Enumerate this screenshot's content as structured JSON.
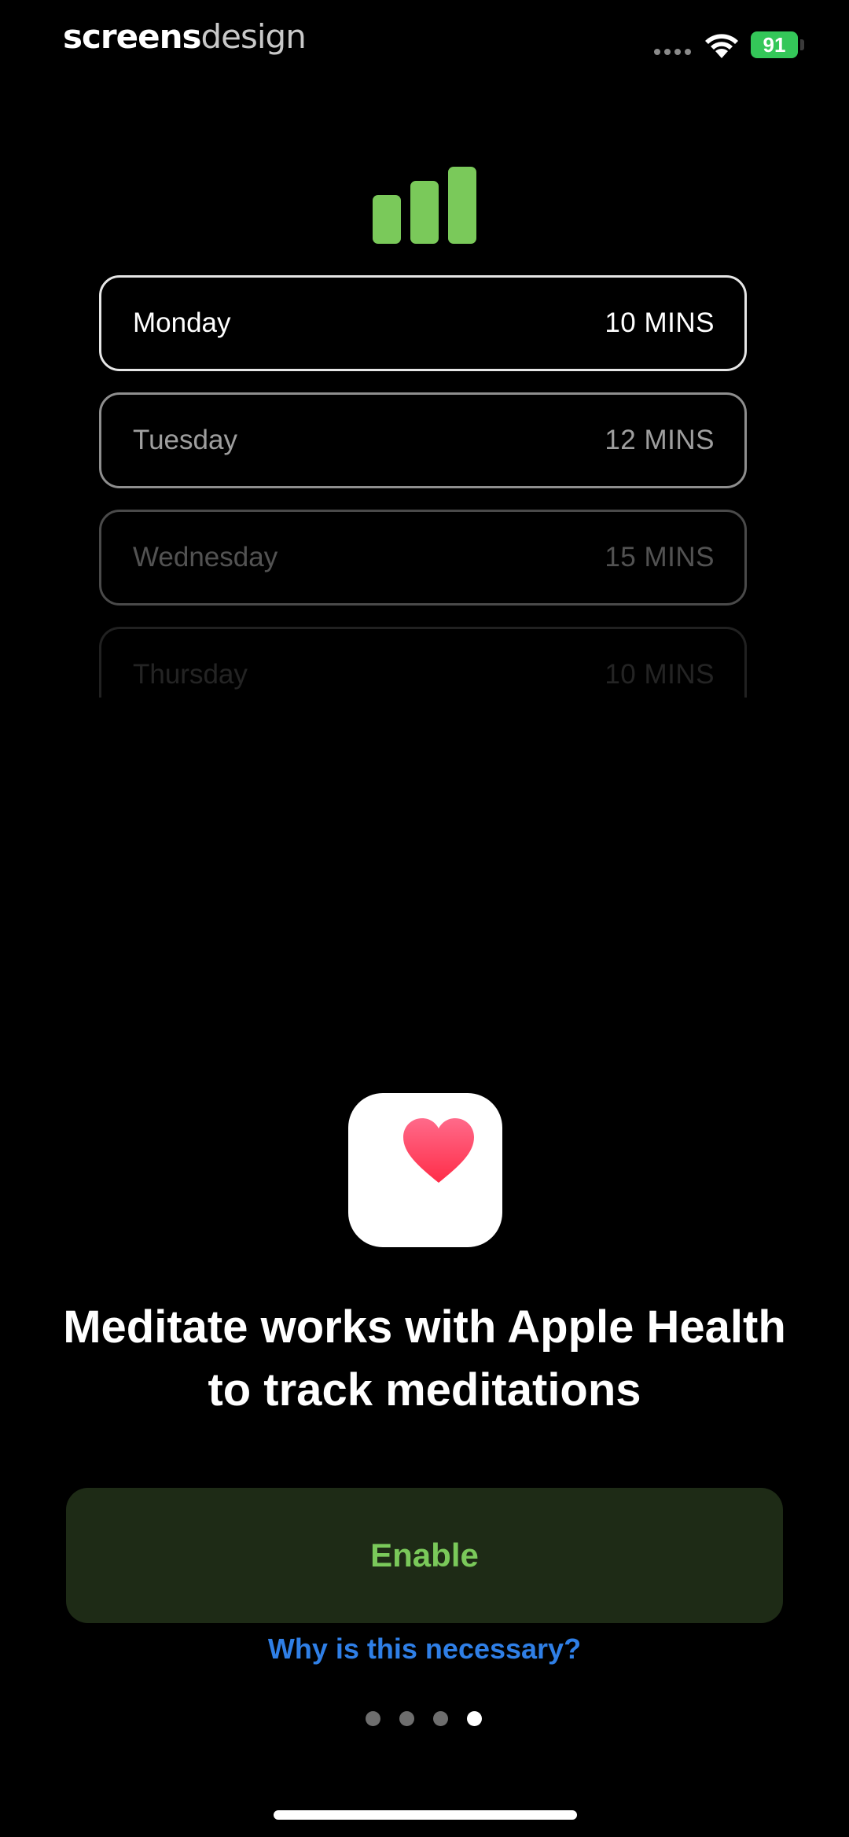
{
  "status_bar": {
    "brand_part1": "screens",
    "brand_part2": "design",
    "battery": "91"
  },
  "colors": {
    "accent_green": "#7ac95a",
    "button_bg": "#1e2b16",
    "link_blue": "#2f7fe6",
    "battery_green": "#34c759"
  },
  "schedule": {
    "rows": [
      {
        "day": "Monday",
        "duration": "10 MINS"
      },
      {
        "day": "Tuesday",
        "duration": "12 MINS"
      },
      {
        "day": "Wednesday",
        "duration": "15 MINS"
      },
      {
        "day": "Thursday",
        "duration": "10 MINS"
      }
    ]
  },
  "icons": {
    "top": "bar-chart-icon",
    "app": "apple-health-heart-icon"
  },
  "headline": "Meditate works with Apple Health to track meditations",
  "enable_label": "Enable",
  "why_link": "Why is this necessary?",
  "pagination": {
    "total": 4,
    "current": 4
  }
}
